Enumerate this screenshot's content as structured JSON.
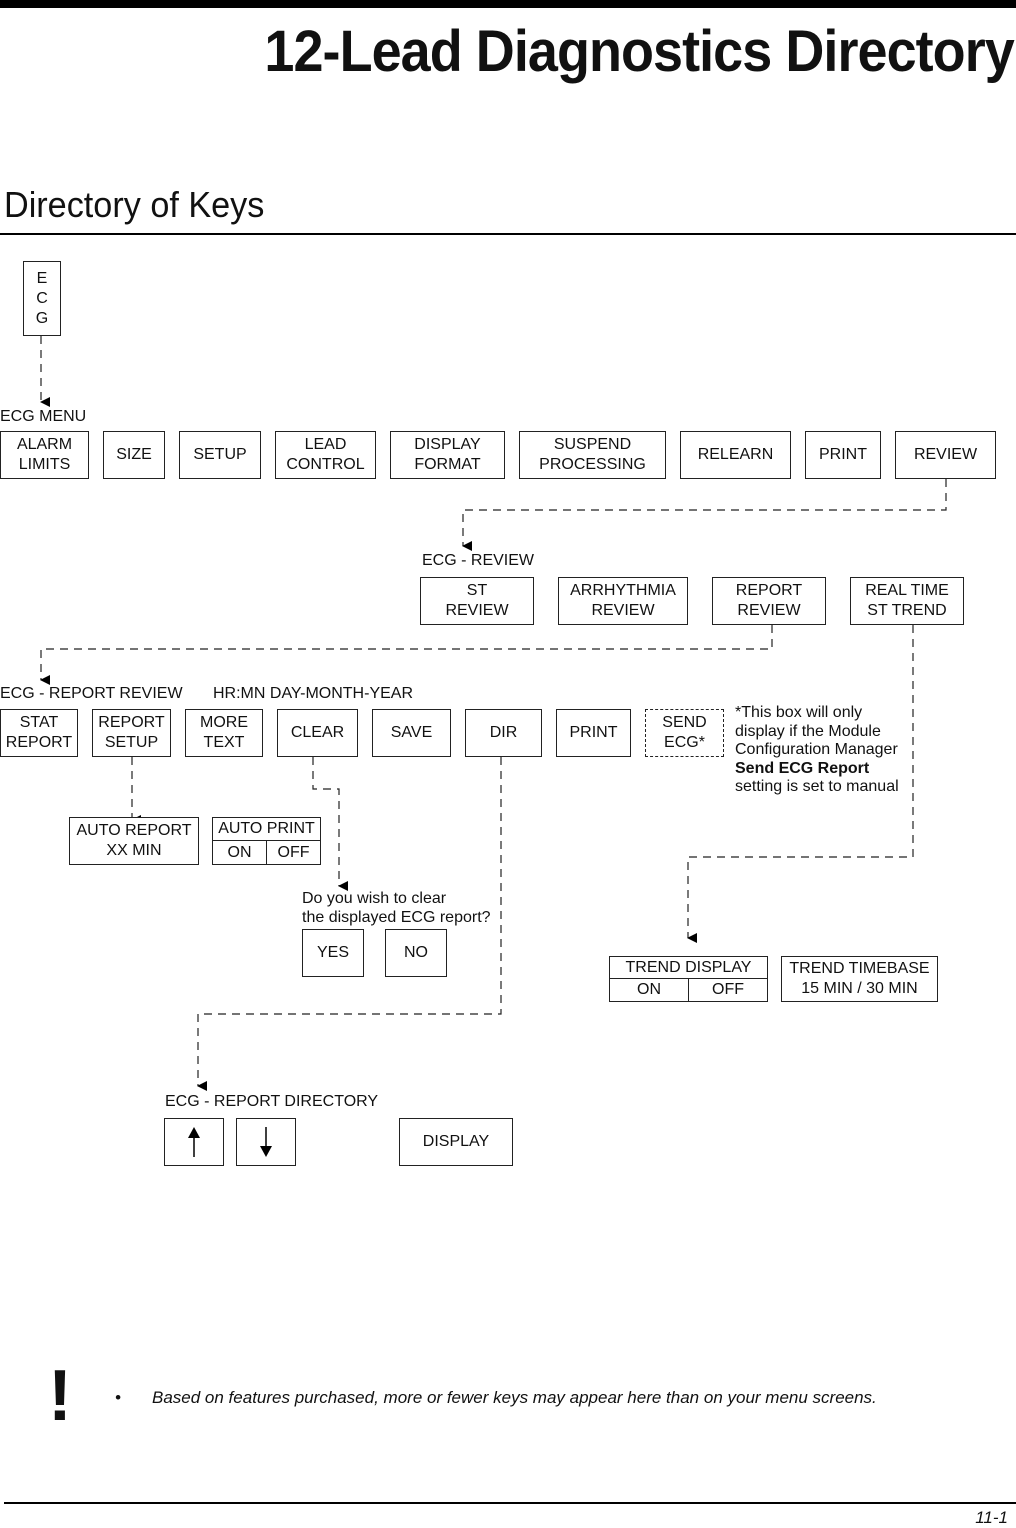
{
  "header": {
    "title": "12-Lead Diagnostics Directory",
    "subtitle": "Directory of Keys"
  },
  "root_key": {
    "label": "E\nC\nG"
  },
  "ecg_menu": {
    "label": "ECG MENU",
    "keys": [
      "ALARM\nLIMITS",
      "SIZE",
      "SETUP",
      "LEAD\nCONTROL",
      "DISPLAY\nFORMAT",
      "SUSPEND\nPROCESSING",
      "RELEARN",
      "PRINT",
      "REVIEW"
    ]
  },
  "ecg_review": {
    "label": "ECG - REVIEW",
    "keys": [
      "ST\nREVIEW",
      "ARRHYTHMIA\nREVIEW",
      "REPORT\nREVIEW",
      "REAL TIME\nST TREND"
    ]
  },
  "report_review": {
    "label": "ECG - REPORT REVIEW",
    "timestamp_format": "HR:MN DAY-MONTH-YEAR",
    "keys": [
      "STAT\nREPORT",
      "REPORT\nSETUP",
      "MORE\nTEXT",
      "CLEAR",
      "SAVE",
      "DIR",
      "PRINT",
      "SEND\nECG*"
    ],
    "footnote_line1": "*This box will only",
    "footnote_line2": "display if the Module",
    "footnote_line3": "Configuration Manager",
    "footnote_bold": "Send ECG Report",
    "footnote_line5": "setting is set to manual"
  },
  "report_setup": {
    "auto_report": "AUTO REPORT\nXX MIN",
    "auto_print": {
      "title": "AUTO PRINT",
      "on": "ON",
      "off": "OFF"
    }
  },
  "clear_confirm": {
    "prompt_line1": "Do you wish to clear",
    "prompt_line2": "the displayed ECG report?",
    "yes": "YES",
    "no": "NO"
  },
  "st_trend": {
    "trend_display": {
      "title": "TREND DISPLAY",
      "on": "ON",
      "off": "OFF"
    },
    "trend_timebase": "TREND TIMEBASE\n15 MIN / 30 MIN"
  },
  "report_directory": {
    "label": "ECG - REPORT DIRECTORY",
    "up_icon": "arrow-up-icon",
    "down_icon": "arrow-down-icon",
    "display": "DISPLAY"
  },
  "footer": {
    "caution_icon": "exclamation-icon",
    "bullet": "•",
    "note": "Based on features purchased, more or fewer keys may appear here than on your menu screens.",
    "page_number": "11-1"
  }
}
